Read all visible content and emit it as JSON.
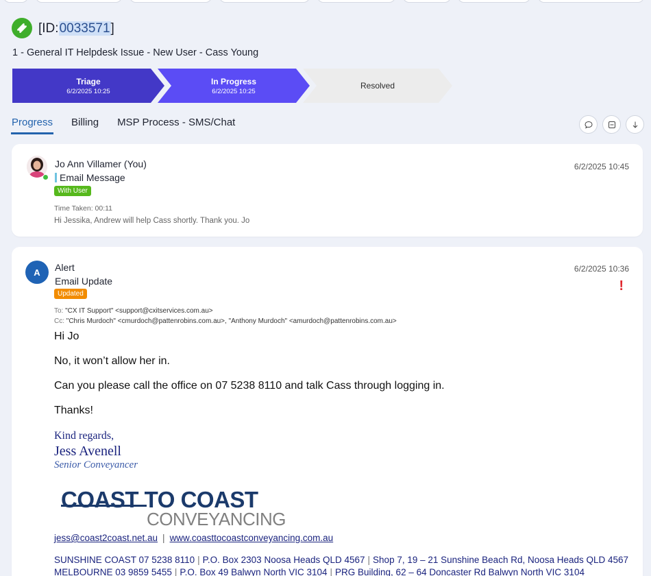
{
  "header": {
    "ticket_id_prefix": "[ID:",
    "ticket_id": "0033571",
    "ticket_id_suffix": "]",
    "ticket_title": "1 - General IT Helpdesk Issue - New User - Cass Young"
  },
  "stages": [
    {
      "name": "Triage",
      "date": "6/2/2025 10:25"
    },
    {
      "name": "In Progress",
      "date": "6/2/2025 10:25"
    },
    {
      "name": "Resolved",
      "date": ""
    }
  ],
  "tabs": [
    {
      "label": "Progress",
      "active": true
    },
    {
      "label": "Billing",
      "active": false
    },
    {
      "label": "MSP Process - SMS/Chat",
      "active": false
    }
  ],
  "entries": [
    {
      "author": "Jo Ann Villamer (You)",
      "type": "Email Message",
      "badge": "With User",
      "date": "6/2/2025 10:45",
      "time_taken": "Time Taken: 00:11",
      "preview": "Hi Jessika, Andrew will help Cass shortly. Thank you. Jo"
    },
    {
      "avatar_letter": "A",
      "author": "Alert",
      "type": "Email Update",
      "badge": "Updated",
      "date": "6/2/2025 10:36",
      "to_label": "To:",
      "to": "\"CX IT Support\" <support@cxitservices.com.au>",
      "cc_label": "Cc:",
      "cc": "\"Chris Murdoch\" <cmurdoch@pattenrobins.com.au>, \"Anthony Murdoch\" <amurdoch@pattenrobins.com.au>",
      "body": [
        "Hi Jo",
        "No, it won’t allow her in.",
        "Can you please call the office on 07 5238 8110 and talk Cass through logging in.",
        "Thanks!"
      ],
      "signature": {
        "regards": "Kind regards,",
        "name": "Jess Avenell",
        "title": "Senior Conveyancer",
        "logo_top": "COAST TO COAST",
        "logo_bottom": "CONVEYANCING",
        "email": "jess@coast2coast.net.au",
        "website": "www.coasttocoastconveyancing.com.au",
        "address_line_1": [
          "SUNSHINE COAST  07 5238 8110",
          "P.O. Box 2303 Noosa Heads QLD 4567",
          "Shop 7, 19 – 21 Sunshine Beach Rd, Noosa Heads QLD 4567"
        ],
        "address_line_2": [
          "MELBOURNE   03 9859 5455",
          "P.O. Box 49 Balwyn North VIC 3104",
          "PRG Building, 62 – 64 Doncaster Rd Balwyn North  VIC 3104"
        ]
      }
    }
  ],
  "colors": {
    "stage_triage": "#4338c7",
    "stage_in_progress": "#5b4cf5",
    "stage_resolved": "#ececec",
    "tab_active": "#2363ad",
    "badge_with_user": "#56b81c",
    "badge_updated": "#f28c00",
    "alert": "#e0272d"
  },
  "icons": {
    "ticket": "ticket-icon",
    "chat": "chat-bubble-icon",
    "collapse": "collapse-icon",
    "download": "arrow-down-icon",
    "priority": "exclamation-icon"
  }
}
